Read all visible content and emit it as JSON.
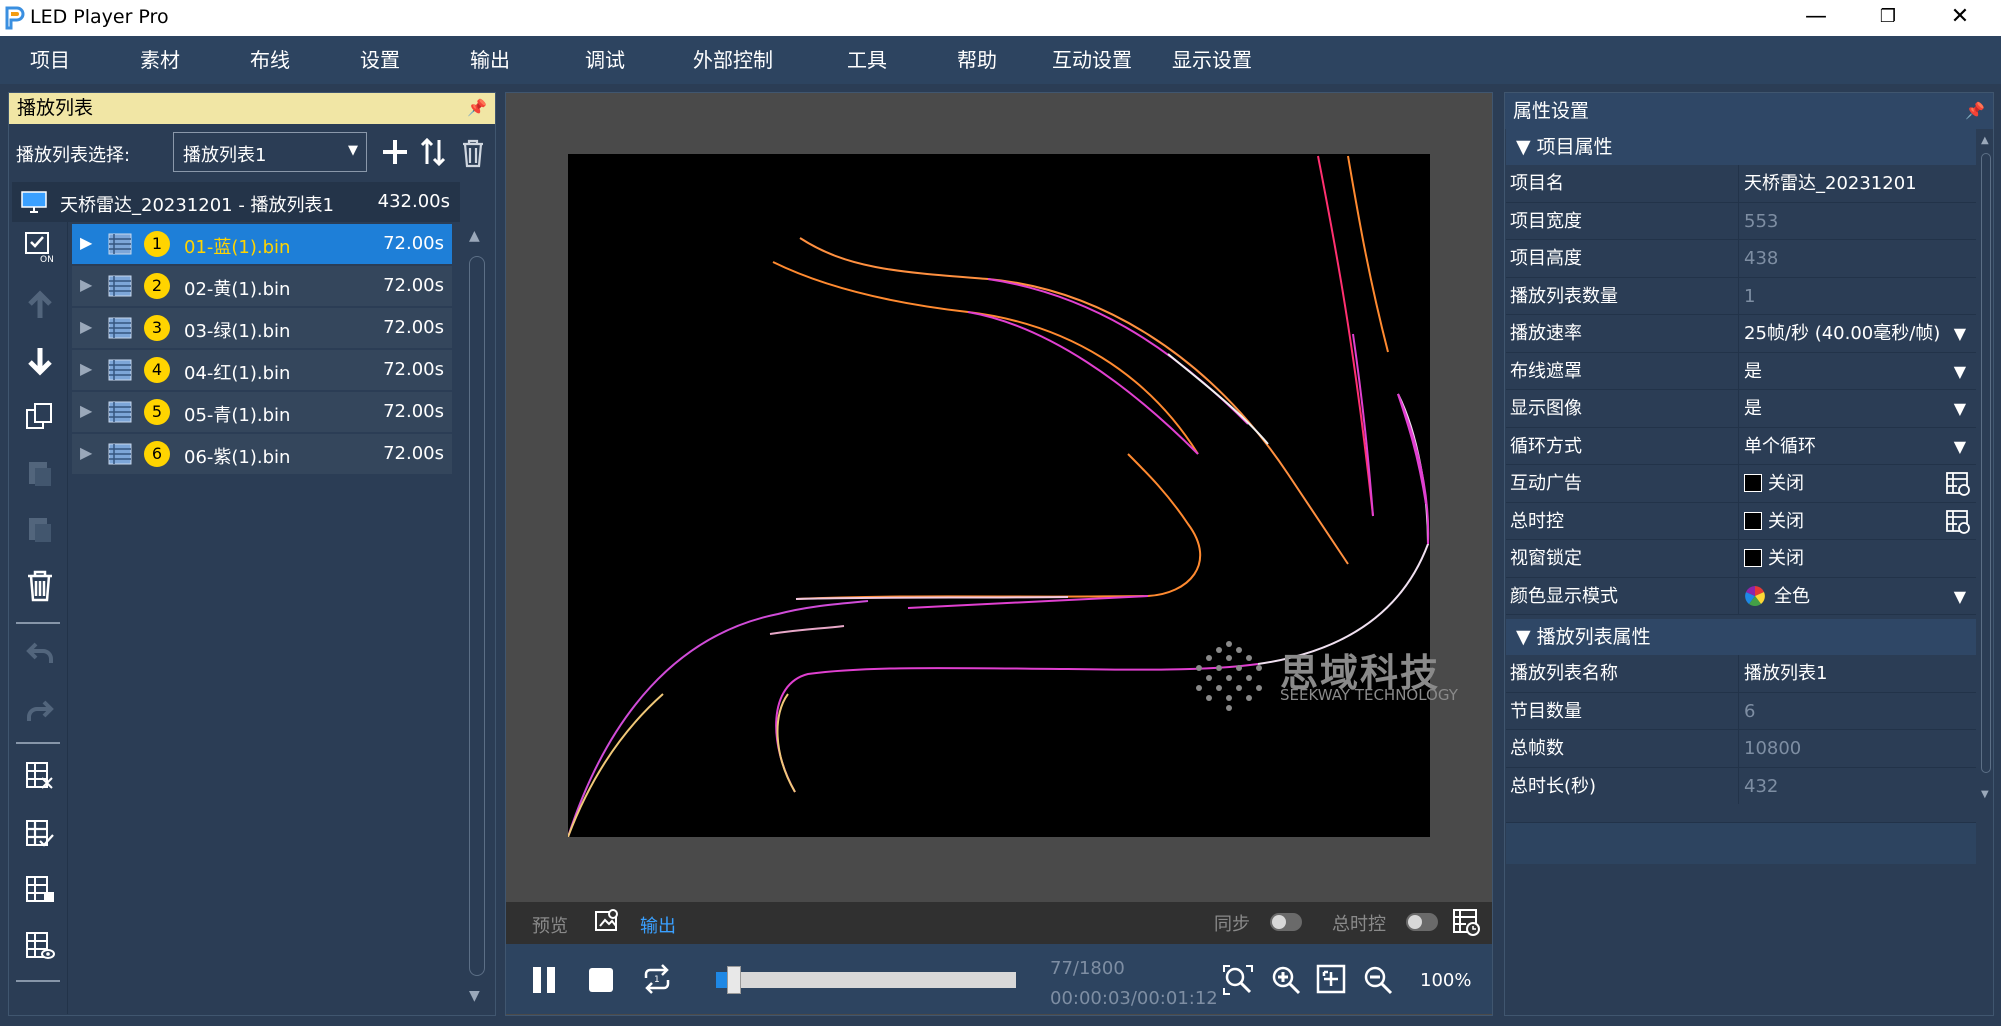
{
  "app": {
    "title": "LED Player Pro",
    "logo": "led-player-logo-icon"
  },
  "window_controls": {
    "minimize": "—",
    "maximize": "❐",
    "close": "✕"
  },
  "menu": [
    "项目",
    "素材",
    "布线",
    "设置",
    "输出",
    "调试",
    "外部控制",
    "工具",
    "帮助",
    "互动设置",
    "显示设置"
  ],
  "playlist_panel": {
    "title": "播放列表",
    "selector_label": "播放列表选择:",
    "selector_value": "播放列表1",
    "project_row": {
      "name": "天桥雷达_20231201 - 播放列表1",
      "duration": "432.00s"
    },
    "items": [
      {
        "num": "1",
        "name": "01-蓝(1).bin",
        "duration": "72.00s",
        "selected": true
      },
      {
        "num": "2",
        "name": "02-黄(1).bin",
        "duration": "72.00s",
        "selected": false
      },
      {
        "num": "3",
        "name": "03-绿(1).bin",
        "duration": "72.00s",
        "selected": false
      },
      {
        "num": "4",
        "name": "04-红(1).bin",
        "duration": "72.00s",
        "selected": false
      },
      {
        "num": "5",
        "name": "05-青(1).bin",
        "duration": "72.00s",
        "selected": false
      },
      {
        "num": "6",
        "name": "06-紫(1).bin",
        "duration": "72.00s",
        "selected": false
      }
    ]
  },
  "preview": {
    "watermark_cn": "思域科技",
    "watermark_en": "SEEKWAY TECHNOLOGY",
    "tab_preview": "预览",
    "tab_output": "输出",
    "sync_label": "同步",
    "master_label": "总时控",
    "frame_counter": "77/1800",
    "time_counter": "00:00:03/00:01:12",
    "zoom": "100%",
    "progress": 0.043
  },
  "properties": {
    "title": "属性设置",
    "section1": "项目属性",
    "rows1": [
      {
        "name": "项目名",
        "value": "天桥雷达_20231201",
        "dim": false,
        "kind": "text"
      },
      {
        "name": "项目宽度",
        "value": "553",
        "dim": true,
        "kind": "text"
      },
      {
        "name": "项目高度",
        "value": "438",
        "dim": true,
        "kind": "text"
      },
      {
        "name": "播放列表数量",
        "value": "1",
        "dim": true,
        "kind": "text"
      },
      {
        "name": "播放速率",
        "value": "25帧/秒 (40.00毫秒/帧)",
        "dim": false,
        "kind": "dropdown"
      },
      {
        "name": "布线遮罩",
        "value": "是",
        "dim": false,
        "kind": "dropdown"
      },
      {
        "name": "显示图像",
        "value": "是",
        "dim": false,
        "kind": "dropdown"
      },
      {
        "name": "循环方式",
        "value": "单个循环",
        "dim": false,
        "kind": "dropdown"
      },
      {
        "name": "互动广告",
        "value": "关闭",
        "dim": false,
        "kind": "checkbox-btn"
      },
      {
        "name": "总时控",
        "value": "关闭",
        "dim": false,
        "kind": "checkbox-btn"
      },
      {
        "name": "视窗锁定",
        "value": "关闭",
        "dim": false,
        "kind": "checkbox"
      },
      {
        "name": "颜色显示模式",
        "value": "全色",
        "dim": false,
        "kind": "color-dropdown"
      }
    ],
    "section2": "播放列表属性",
    "rows2": [
      {
        "name": "播放列表名称",
        "value": "播放列表1",
        "dim": false
      },
      {
        "name": "节目数量",
        "value": "6",
        "dim": true
      },
      {
        "name": "总帧数",
        "value": "10800",
        "dim": true
      },
      {
        "name": "总时长(秒)",
        "value": "432",
        "dim": true
      }
    ]
  },
  "colors": {
    "accent": "#1e88e5",
    "badge": "#ffd400",
    "selected_row": "#1e7fd8",
    "output_tab": "#3aa0ff"
  }
}
